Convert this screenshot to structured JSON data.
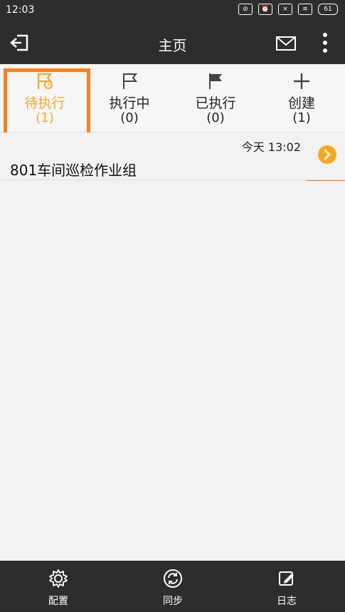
{
  "status": {
    "time": "12:03",
    "battery": "61"
  },
  "appbar": {
    "title": "主页"
  },
  "tabs": [
    {
      "label": "待执行",
      "count": "(1)"
    },
    {
      "label": "执行中",
      "count": "(0)"
    },
    {
      "label": "已执行",
      "count": "(0)"
    },
    {
      "label": "创建",
      "count": "(1)"
    }
  ],
  "list": [
    {
      "time": "今天 13:02",
      "title": "801车间巡检作业组"
    }
  ],
  "bottom": [
    {
      "label": "配置"
    },
    {
      "label": "同步"
    },
    {
      "label": "日志"
    }
  ],
  "colors": {
    "accent": "#f6a823",
    "highlight": "#f58220",
    "bar": "#2d2d2d"
  }
}
